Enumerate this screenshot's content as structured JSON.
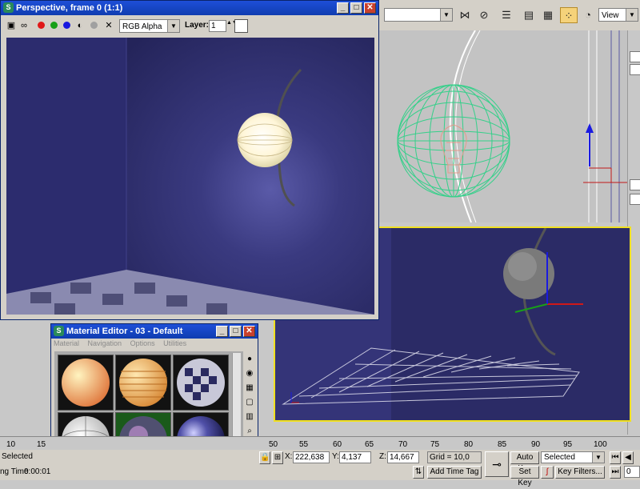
{
  "render_window": {
    "title": "Perspective, frame 0 (1:1)",
    "channel_select": "RGB Alpha",
    "layer_label": "Layer:",
    "layer_value": "1"
  },
  "main_toolbar": {
    "view_select": "View"
  },
  "material_editor": {
    "title": "Material Editor - 03 - Default",
    "menu": [
      "Material",
      "Navigation",
      "Options",
      "Utilities"
    ],
    "slots": [
      "peach-sphere",
      "striped-orange-sphere",
      "checker-sphere",
      "white-lamp-sphere",
      "reflective-sphere",
      "blue-glossy-sphere"
    ]
  },
  "timeline": {
    "ticks": [
      "10",
      "15",
      "50",
      "55",
      "60",
      "65",
      "70",
      "75",
      "80",
      "85",
      "90",
      "95",
      "100"
    ]
  },
  "status": {
    "selected_left": "Selected",
    "time_label": "ng Time",
    "time_value": "0:00:01",
    "x_label": "X:",
    "x_value": "222,638",
    "y_label": "Y:",
    "y_value": "4,137",
    "z_label": "Z:",
    "z_value": "14,667",
    "grid": "Grid = 10,0",
    "add_time_tag": "Add Time Tag",
    "auto_key": "Auto Key",
    "set_key": "Set Key",
    "selected_filter": "Selected",
    "key_filters": "Key Filters...",
    "frame_value": "0"
  },
  "colors": {
    "titlebar": "#0f3cb0",
    "selected_viewport_border": "#f0e020",
    "wireframe_green": "#35d08a"
  }
}
